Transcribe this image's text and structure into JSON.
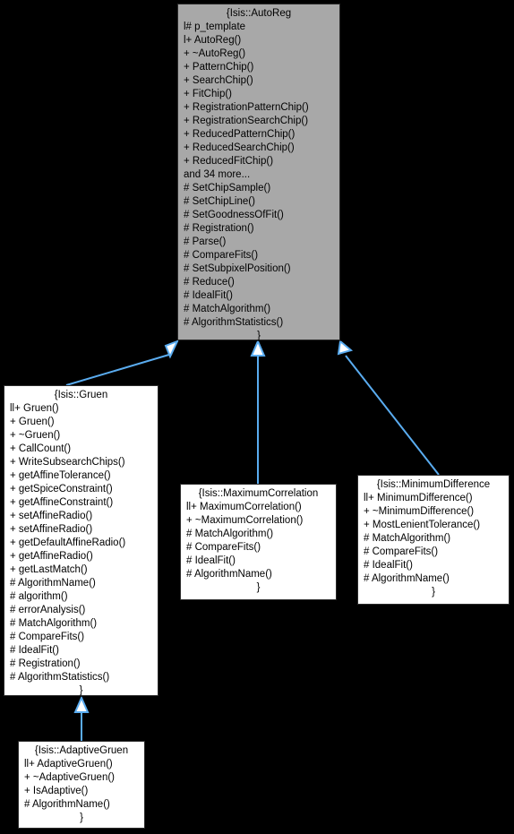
{
  "diagram": {
    "kind": "uml-class-inheritance-diagram",
    "background_color": "#000000",
    "edge_color": "#5aacf0",
    "base_fill_color": "#a8a8a8",
    "derived_fill_color": "#ffffff",
    "border_color": "#2b2b2b",
    "text_color": "#000000"
  },
  "nodes": {
    "autoreg": {
      "title": "{Isis::AutoReg",
      "close": "}",
      "members": [
        "l# p_template",
        "l+ AutoReg()",
        "+ ~AutoReg()",
        "+ PatternChip()",
        "+ SearchChip()",
        "+ FitChip()",
        "+ RegistrationPatternChip()",
        "+ RegistrationSearchChip()",
        "+ ReducedPatternChip()",
        "+ ReducedSearchChip()",
        "+ ReducedFitChip()",
        "and 34 more...",
        "# SetChipSample()",
        "# SetChipLine()",
        "# SetGoodnessOfFit()",
        "# Registration()",
        "# Parse()",
        "# CompareFits()",
        "# SetSubpixelPosition()",
        "# Reduce()",
        "# IdealFit()",
        "# MatchAlgorithm()",
        "# AlgorithmStatistics()"
      ]
    },
    "gruen": {
      "title": "{Isis::Gruen",
      "close": "}",
      "members": [
        "ll+ Gruen()",
        "+ Gruen()",
        "+ ~Gruen()",
        "+ CallCount()",
        "+ WriteSubsearchChips()",
        "+ getAffineTolerance()",
        "+ getSpiceConstraint()",
        "+ getAffineConstraint()",
        "+ setAffineRadio()",
        "+ setAffineRadio()",
        "+ getDefaultAffineRadio()",
        "+ getAffineRadio()",
        "+ getLastMatch()",
        "# AlgorithmName()",
        "# algorithm()",
        "# errorAnalysis()",
        "# MatchAlgorithm()",
        "# CompareFits()",
        "# IdealFit()",
        "# Registration()",
        "# AlgorithmStatistics()"
      ]
    },
    "maximumcorrelation": {
      "title": "{Isis::MaximumCorrelation",
      "close": "}",
      "members": [
        "ll+ MaximumCorrelation()",
        "+ ~MaximumCorrelation()",
        "# MatchAlgorithm()",
        "# CompareFits()",
        "# IdealFit()",
        "# AlgorithmName()"
      ]
    },
    "minimumdifference": {
      "title": "{Isis::MinimumDifference",
      "close": "}",
      "members": [
        "ll+ MinimumDifference()",
        "+ ~MinimumDifference()",
        "+ MostLenientTolerance()",
        "# MatchAlgorithm()",
        "# CompareFits()",
        "# IdealFit()",
        "# AlgorithmName()"
      ]
    },
    "adaptivegruen": {
      "title": "{Isis::AdaptiveGruen",
      "close": "}",
      "members": [
        "ll+ AdaptiveGruen()",
        "+ ~AdaptiveGruen()",
        "+ IsAdaptive()",
        "# AlgorithmName()"
      ]
    }
  },
  "edges": [
    {
      "from": "gruen",
      "to": "autoreg"
    },
    {
      "from": "maximumcorrelation",
      "to": "autoreg"
    },
    {
      "from": "minimumdifference",
      "to": "autoreg"
    },
    {
      "from": "adaptivegruen",
      "to": "gruen"
    }
  ]
}
